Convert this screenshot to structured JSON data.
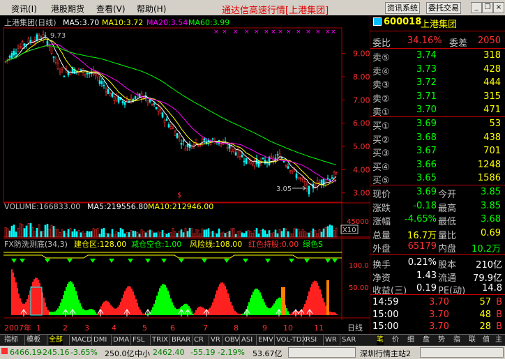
{
  "menubar": {
    "items": [
      "资讯(I)",
      "港股期货",
      "查看(V)",
      "帮助(H)"
    ],
    "title": "通达信高速行情[上港集团]",
    "buttons": [
      "资讯系统",
      "委托交易"
    ],
    "window_controls": [
      "minimize-icon",
      "restore-icon",
      "close-icon"
    ]
  },
  "main_chart": {
    "title": "上港集团(日线)",
    "ma": [
      {
        "label": "MA5:3.70",
        "color": "#ffffff"
      },
      {
        "label": "MA10:3.72",
        "color": "#ffff00"
      },
      {
        "label": "MA20:3.54",
        "color": "#ff00ff"
      },
      {
        "label": "MA60:3.99",
        "color": "#00ff00"
      }
    ],
    "high_label": "9.73",
    "low_label": "3.05",
    "y_ticks": [
      "9.00",
      "8.00",
      "7.00",
      "6.00",
      "5.00",
      "4.00",
      "3.00"
    ],
    "y_values": [
      9,
      8,
      7,
      6,
      5,
      4,
      3
    ],
    "ylim": [
      2.6,
      10.1
    ]
  },
  "volume": {
    "label": "VOLUME:166833.00",
    "ma5": "MA5:219556.80",
    "ma10": "MA10:212946.00",
    "axis": "45000",
    "unit": "X10"
  },
  "indicator": {
    "name": "FX防洗测底(34,3)",
    "items": [
      {
        "label": "建仓区:128.00",
        "color": "#ffff00"
      },
      {
        "label": "减仓空仓:1.00",
        "color": "#00ff00"
      },
      {
        "label": "风险线:108.00",
        "color": "#ffff00"
      },
      {
        "label": "红色持股:0.00",
        "color": "#ff3030"
      },
      {
        "label": "绿色S",
        "color": "#00ff00"
      }
    ],
    "y_ticks": [
      "100.0",
      "50.00"
    ]
  },
  "x_axis": {
    "year_label": "2007年",
    "months": [
      "1",
      "2",
      "3",
      "4",
      "5",
      "6",
      "7",
      "8",
      "9",
      "10",
      "11"
    ],
    "period": "日线"
  },
  "quote_panel": {
    "stock_code": "600018",
    "stock_name": "上港集团",
    "ratio": {
      "label1": "委比",
      "value1": "34.16%",
      "label2": "委差",
      "value2": "2050"
    },
    "asks": [
      {
        "label": "卖⑤",
        "price": "3.74",
        "volume": "318"
      },
      {
        "label": "卖④",
        "price": "3.73",
        "volume": "428"
      },
      {
        "label": "卖③",
        "price": "3.72",
        "volume": "444"
      },
      {
        "label": "卖②",
        "price": "3.71",
        "volume": "315"
      },
      {
        "label": "卖①",
        "price": "3.70",
        "volume": "471"
      }
    ],
    "bids": [
      {
        "label": "买①",
        "price": "3.69",
        "volume": "53"
      },
      {
        "label": "买②",
        "price": "3.68",
        "volume": "438"
      },
      {
        "label": "买③",
        "price": "3.67",
        "volume": "701"
      },
      {
        "label": "买④",
        "price": "3.66",
        "volume": "1248"
      },
      {
        "label": "买⑤",
        "price": "3.65",
        "volume": "1586"
      }
    ],
    "stats": [
      {
        "l1": "现价",
        "v1": "3.69",
        "c1": "#00ff00",
        "l2": "今开",
        "v2": "3.85",
        "c2": "#00ff00"
      },
      {
        "l1": "涨跌",
        "v1": "-0.18",
        "c1": "#00ff00",
        "l2": "最高",
        "v2": "3.85",
        "c2": "#00ff00"
      },
      {
        "l1": "涨幅",
        "v1": "-4.65%",
        "c1": "#00ff00",
        "l2": "最低",
        "v2": "3.68",
        "c2": "#00ff00"
      },
      {
        "l1": "总量",
        "v1": "16.7万",
        "c1": "#ffff00",
        "l2": "量比",
        "v2": "0.69",
        "c2": "#ffff00"
      },
      {
        "l1": "外盘",
        "v1": "65179",
        "c1": "#ff3030",
        "l2": "内盘",
        "v2": "10.2万",
        "c2": "#00ff00"
      }
    ],
    "fundamentals": [
      {
        "l1": "换手",
        "v1": "0.21%",
        "l2": "股本",
        "v2": "210亿"
      },
      {
        "l1": "净资",
        "v1": "1.43",
        "l2": "流通",
        "v2": "79.9亿"
      },
      {
        "l1": "收益(三)",
        "v1": "0.19",
        "l2": "PE(动)",
        "v2": "14.8"
      }
    ],
    "ticks": [
      {
        "time": "14:59",
        "price": "3.70",
        "volume": "57",
        "flag": "B"
      },
      {
        "time": "15:00",
        "price": "3.70",
        "volume": "48",
        "flag": "B"
      },
      {
        "time": "15:00",
        "price": "3.70",
        "volume": "28",
        "flag": "B"
      }
    ]
  },
  "bottom_tabs": [
    "指标",
    "模板",
    "全部",
    "MACD",
    "DMI",
    "DMA",
    "FSL",
    "TRIX",
    "BRAR",
    "CR",
    "VR",
    "OBV",
    "ASI",
    "EMV",
    "VOL-TDX",
    "RSI",
    "WR",
    "SAR"
  ],
  "side_tabs": [
    "笔",
    "价",
    "细",
    "盘",
    "势",
    "指",
    "联",
    "值",
    "主"
  ],
  "statusbar": {
    "sh_index": "6466.19",
    "sh_change": "-245.16",
    "sh_pct": "-3.65%",
    "sh_amount": "250.0亿",
    "sz_label": "中小",
    "sz_index": "2462.40",
    "sz_change": "-55.19",
    "sz_pct": "-2.19%",
    "sz_amount": "53.67亿",
    "server": "深圳行情主站2"
  },
  "colors": {
    "up": "#ff3030",
    "down": "#00ffff",
    "grid": "#8b0000",
    "ma5": "#ffffff",
    "ma10": "#ffff00",
    "ma20": "#ff00ff",
    "ma60": "#00ff00"
  }
}
